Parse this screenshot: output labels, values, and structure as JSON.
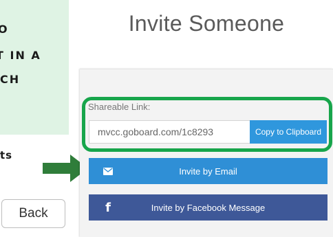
{
  "callout": {
    "line1": "O",
    "line2": "T IN A",
    "line3": "CH",
    "fragment": "ts"
  },
  "back_button": {
    "label": "Back"
  },
  "modal": {
    "title": "Invite Someone",
    "share": {
      "label": "Shareable Link:",
      "value": "mvcc.goboard.com/1c8293",
      "copy_label": "Copy to Clipboard"
    },
    "email_button": {
      "label": "Invite by Email",
      "icon": "envelope-icon"
    },
    "facebook_button": {
      "label": "Invite by Facebook Message",
      "icon": "facebook-icon"
    }
  },
  "colors": {
    "highlight": "#17a54b",
    "callout_bg": "#dff3e4",
    "email_blue": "#2f8fd6",
    "facebook_blue": "#3e5898",
    "copy_blue": "#2f97dd"
  }
}
